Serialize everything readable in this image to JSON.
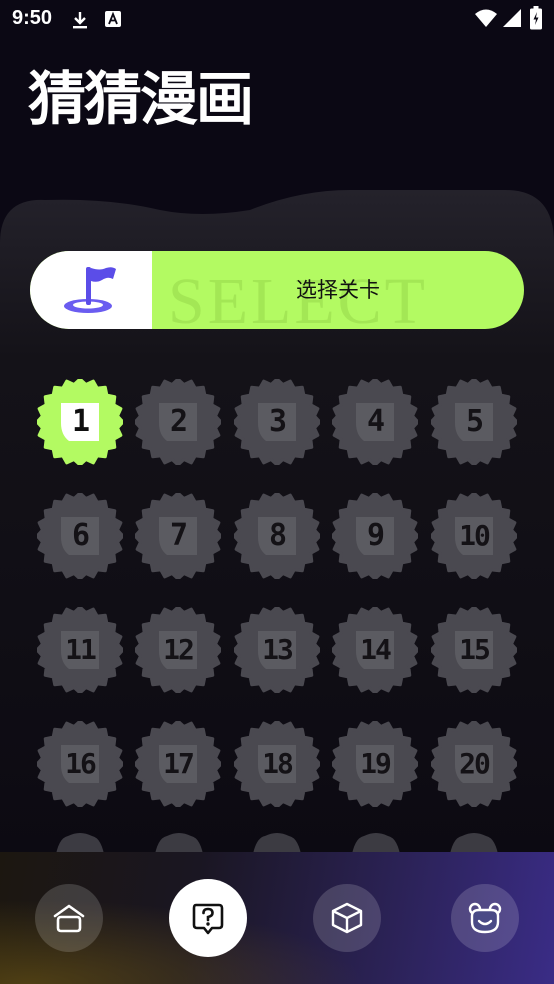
{
  "status_bar": {
    "time": "9:50"
  },
  "app": {
    "title": "猜猜漫画"
  },
  "select_banner": {
    "label": "选择关卡",
    "background_word": "SELECT",
    "icon": "flag-icon"
  },
  "levels": {
    "active_level": "1",
    "items": [
      "1",
      "2",
      "3",
      "4",
      "5",
      "6",
      "7",
      "8",
      "9",
      "10",
      "11",
      "12",
      "13",
      "14",
      "15",
      "16",
      "17",
      "18",
      "19",
      "20"
    ]
  },
  "bottom_nav": {
    "items": [
      {
        "name": "home",
        "icon": "home-icon"
      },
      {
        "name": "question",
        "icon": "question-chat-icon",
        "active": true
      },
      {
        "name": "box",
        "icon": "box-icon"
      },
      {
        "name": "profile",
        "icon": "bear-icon"
      }
    ]
  },
  "colors": {
    "background": "#0b0814",
    "accent": "#b3fa62",
    "level_inactive": "#4a4950",
    "nav_gradient_end": "#3a2c86"
  }
}
